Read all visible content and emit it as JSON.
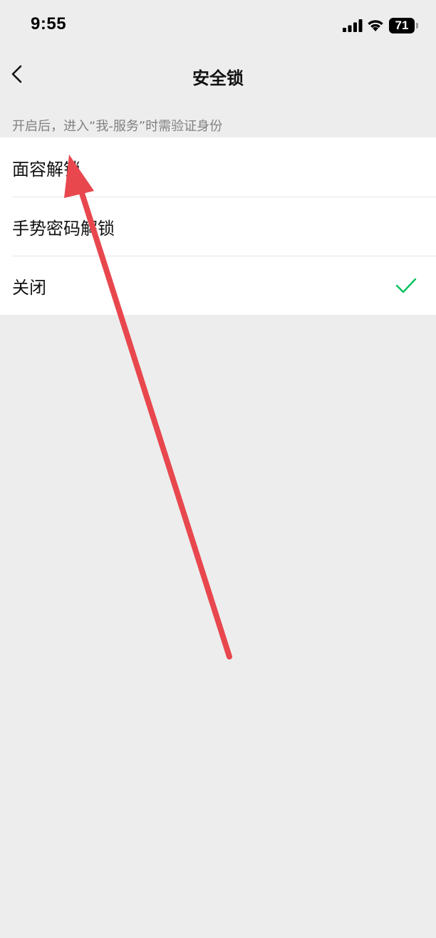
{
  "status_bar": {
    "time": "9:55",
    "battery_level": "71",
    "icons": [
      "signal-icon",
      "wifi-icon",
      "battery-icon"
    ]
  },
  "nav": {
    "back_icon": "chevron-left-icon",
    "title": "安全锁"
  },
  "description": "开启后，进入“我-服务”时需验证身份",
  "options": [
    {
      "label": "面容解锁",
      "selected": false
    },
    {
      "label": "手势密码解锁",
      "selected": false
    },
    {
      "label": "关闭",
      "selected": true
    }
  ],
  "colors": {
    "background": "#ededed",
    "card": "#ffffff",
    "check": "#07c160",
    "annotation_arrow": "#e8474e",
    "secondary_text": "#808080"
  },
  "overlay": {
    "annotation": "red-arrow-pointing-to-face-unlock"
  }
}
